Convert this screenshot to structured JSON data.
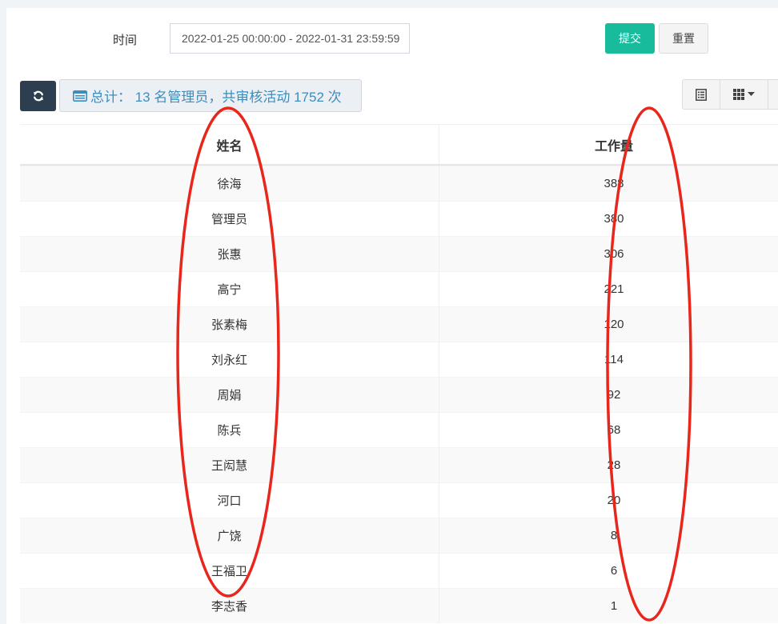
{
  "filter": {
    "time_label": "时间",
    "time_value": "2022-01-25 00:00:00 - 2022-01-31 23:59:59",
    "submit_label": "提交",
    "reset_label": "重置"
  },
  "toolbar": {
    "refresh_icon": "refresh-icon",
    "summary_icon": "list-alt-icon",
    "summary_text": "总计： 13 名管理员，共审核活动 1752 次",
    "list_icon": "list-view-icon",
    "columns_icon": "grid-columns-icon"
  },
  "table": {
    "headers": {
      "name": "姓名",
      "workload": "工作量"
    },
    "rows": [
      {
        "name": "徐海",
        "workload": "388"
      },
      {
        "name": "管理员",
        "workload": "380"
      },
      {
        "name": "张惠",
        "workload": "306"
      },
      {
        "name": "高宁",
        "workload": "221"
      },
      {
        "name": "张素梅",
        "workload": "120"
      },
      {
        "name": "刘永红",
        "workload": "114"
      },
      {
        "name": "周娟",
        "workload": "92"
      },
      {
        "name": "陈兵",
        "workload": "68"
      },
      {
        "name": "王闳慧",
        "workload": "28"
      },
      {
        "name": "河口",
        "workload": "20"
      },
      {
        "name": "广饶",
        "workload": "8"
      },
      {
        "name": "王福卫",
        "workload": "6"
      },
      {
        "name": "李志香",
        "workload": "1"
      }
    ]
  },
  "colors": {
    "submit": "#18bc9c",
    "refresh": "#2c3e50",
    "summary_text": "#3c8dbc",
    "annotation": "#e8261c"
  }
}
